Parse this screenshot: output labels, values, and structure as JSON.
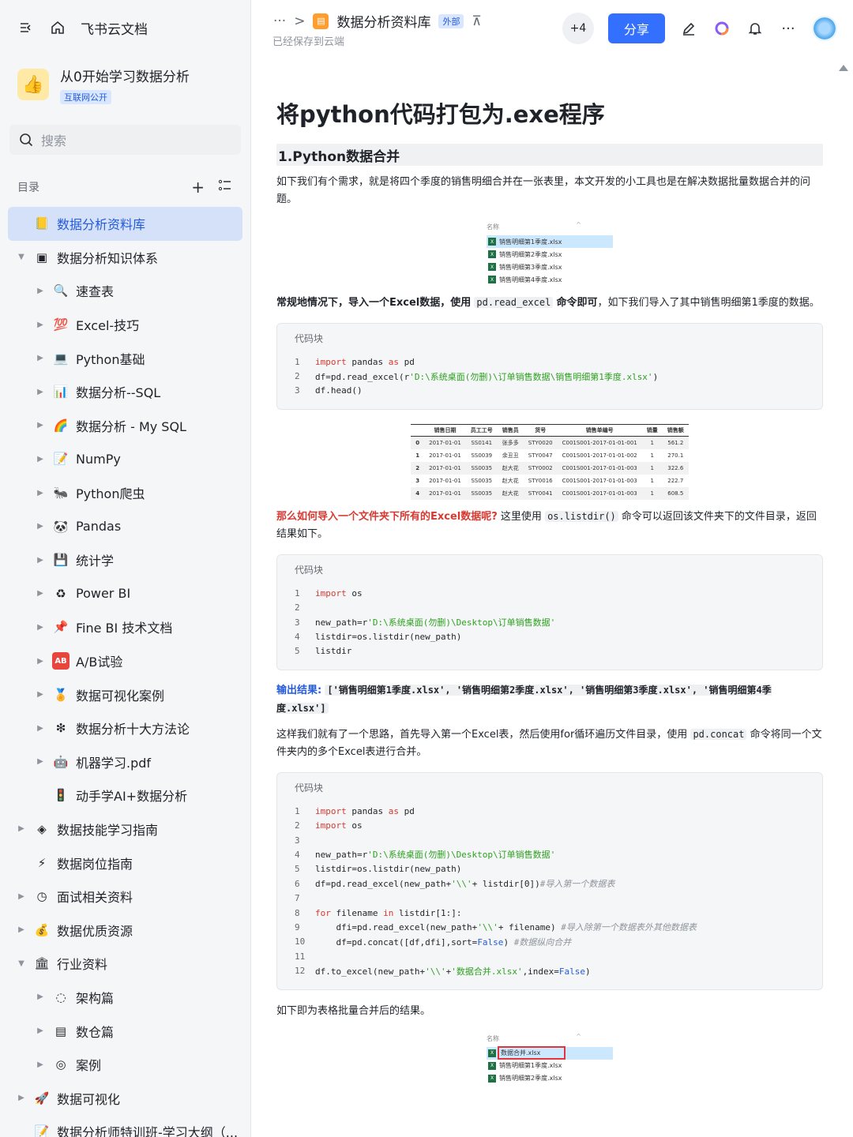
{
  "sidebar": {
    "brand": "飞书云文档",
    "space_name": "从0开始学习数据分析",
    "space_tag": "互联网公开",
    "search_placeholder": "搜索",
    "toc_label": "目录",
    "items": [
      {
        "label": "数据分析资料库",
        "icon": "📒",
        "level": 0,
        "caret": "",
        "active": true
      },
      {
        "label": "数据分析知识体系",
        "icon": "▣",
        "level": 0,
        "caret": "▼"
      },
      {
        "label": "速查表",
        "icon": "🔍",
        "level": 1,
        "caret": "▶"
      },
      {
        "label": "Excel-技巧",
        "icon": "💯",
        "level": 1,
        "caret": "▶"
      },
      {
        "label": "Python基础",
        "icon": "💻",
        "level": 1,
        "caret": "▶"
      },
      {
        "label": "数据分析--SQL",
        "icon": "📊",
        "level": 1,
        "caret": "▶"
      },
      {
        "label": "数据分析 - My SQL",
        "icon": "🌈",
        "level": 1,
        "caret": "▶"
      },
      {
        "label": "NumPy",
        "icon": "📝",
        "level": 1,
        "caret": "▶"
      },
      {
        "label": "Python爬虫",
        "icon": "🐜",
        "level": 1,
        "caret": "▶"
      },
      {
        "label": "Pandas",
        "icon": "🐼",
        "level": 1,
        "caret": "▶"
      },
      {
        "label": "统计学",
        "icon": "💾",
        "level": 1,
        "caret": "▶"
      },
      {
        "label": "Power BI",
        "icon": "♻",
        "level": 1,
        "caret": "▶"
      },
      {
        "label": "Fine BI 技术文档",
        "icon": "📌",
        "level": 1,
        "caret": "▶"
      },
      {
        "label": "A/B试验",
        "icon": "AB",
        "level": 1,
        "caret": "▶"
      },
      {
        "label": "数据可视化案例",
        "icon": "🏅",
        "level": 1,
        "caret": "▶"
      },
      {
        "label": "数据分析十大方法论",
        "icon": "❇",
        "level": 1,
        "caret": "▶"
      },
      {
        "label": "机器学习.pdf",
        "icon": "🤖",
        "level": 1,
        "caret": "▶"
      },
      {
        "label": "动手学AI+数据分析",
        "icon": "🚦",
        "level": 1,
        "caret": ""
      },
      {
        "label": "数据技能学习指南",
        "icon": "◈",
        "level": 0,
        "caret": "▶"
      },
      {
        "label": "数据岗位指南",
        "icon": "⚡",
        "level": 0,
        "caret": ""
      },
      {
        "label": "面试相关资料",
        "icon": "◷",
        "level": 0,
        "caret": "▶"
      },
      {
        "label": "数据优质资源",
        "icon": "💰",
        "level": 0,
        "caret": "▶"
      },
      {
        "label": "行业资料",
        "icon": "🏛",
        "level": 0,
        "caret": "▼"
      },
      {
        "label": "架构篇",
        "icon": "◌",
        "level": 1,
        "caret": "▶"
      },
      {
        "label": "数仓篇",
        "icon": "▤",
        "level": 1,
        "caret": "▶"
      },
      {
        "label": "案例",
        "icon": "◎",
        "level": 1,
        "caret": "▶"
      },
      {
        "label": "数据可视化",
        "icon": "🚀",
        "level": 0,
        "caret": "▶"
      },
      {
        "label": "数据分析师特训班-学习大纲（...",
        "icon": "📝",
        "level": 0,
        "caret": ""
      }
    ]
  },
  "topbar": {
    "more": "···",
    "sep": ">",
    "doc_title": "数据分析资料库",
    "ext_tag": "外部",
    "saved": "已经保存到云端",
    "collab_count": "+4",
    "share": "分享"
  },
  "doc": {
    "title": "将python代码打包为.exe程序",
    "h2": "1.Python数据合并",
    "p1": "如下我们有个需求，就是将四个季度的销售明细合并在一张表里，本文开发的小工具也是在解决数据批量数据合并的问题。",
    "files1": {
      "header": "名称",
      "rows": [
        "销售明细第1季度.xlsx",
        "销售明细第2季度.xlsx",
        "销售明细第3季度.xlsx",
        "销售明细第4季度.xlsx"
      ]
    },
    "p2_bold": "常规地情况下，导入一个Excel数据，使用",
    "p2_code": "pd.read_excel",
    "p2_bold2": "命令即可",
    "p2_rest": "，如下我们导入了其中销售明细第1季度的数据。",
    "code1": {
      "label": "代码块",
      "lines": [
        "import pandas as pd",
        "df=pd.read_excel(r'D:\\系统桌面(勿删)\\订单销售数据\\销售明细第1季度.xlsx')",
        "df.head()"
      ]
    },
    "table": {
      "headers": [
        "",
        "销售日期",
        "员工工号",
        "销售员",
        "货号",
        "销售单编号",
        "销量",
        "销售额"
      ],
      "rows": [
        [
          "0",
          "2017-01-01",
          "SS0141",
          "张多多",
          "STY0020",
          "C001S001-2017-01-01-001",
          "1",
          "561.2"
        ],
        [
          "1",
          "2017-01-01",
          "SS0039",
          "余丑丑",
          "STY0047",
          "C001S001-2017-01-01-002",
          "1",
          "270.1"
        ],
        [
          "2",
          "2017-01-01",
          "SS0035",
          "赵大花",
          "STY0002",
          "C001S001-2017-01-01-003",
          "1",
          "322.6"
        ],
        [
          "3",
          "2017-01-01",
          "SS0035",
          "赵大花",
          "STY0016",
          "C001S001-2017-01-01-003",
          "1",
          "222.7"
        ],
        [
          "4",
          "2017-01-01",
          "SS0035",
          "赵大花",
          "STY0041",
          "C001S001-2017-01-01-003",
          "1",
          "608.5"
        ]
      ]
    },
    "p3_red": "那么如何导入一个文件夹下所有的Excel数据呢?",
    "p3_a": " 这里使用",
    "p3_code": "os.listdir()",
    "p3_b": "命令可以返回该文件夹下的文件目录，返回结果如下。",
    "code2": {
      "label": "代码块",
      "lines": [
        "import os",
        "",
        "new_path=r'D:\\系统桌面(勿删)\\Desktop\\订单销售数据'",
        "listdir=os.listdir(new_path)",
        "listdir"
      ]
    },
    "p4_label": "输出结果:",
    "p4_code": "['销售明细第1季度.xlsx', '销售明细第2季度.xlsx', '销售明细第3季度.xlsx', '销售明细第4季度.xlsx']",
    "p5_a": "这样我们就有了一个思路，首先导入第一个Excel表，然后使用for循环遍历文件目录，使用",
    "p5_code": "pd.concat",
    "p5_b": "命令将同一个文件夹内的多个Excel表进行合并。",
    "code3": {
      "label": "代码块",
      "lines": [
        "import pandas as pd",
        "import os",
        "",
        "new_path=r'D:\\系统桌面(勿删)\\Desktop\\订单销售数据'",
        "listdir=os.listdir(new_path)",
        "df=pd.read_excel(new_path+'\\\\'+ listdir[0])#导入第一个数据表",
        "",
        "for filename in listdir[1:]:",
        "    dfi=pd.read_excel(new_path+'\\\\'+ filename) #导入除第一个数据表外其他数据表",
        "    df=pd.concat([df,dfi],sort=False) #数据纵向合并",
        "",
        "df.to_excel(new_path+'\\\\'+'数据合并.xlsx',index=False)"
      ]
    },
    "p6": "如下即为表格批量合并后的结果。",
    "files2": {
      "header": "名称",
      "rows": [
        "数据合并.xlsx",
        "销售明细第1季度.xlsx",
        "销售明细第2季度.xlsx"
      ]
    }
  }
}
